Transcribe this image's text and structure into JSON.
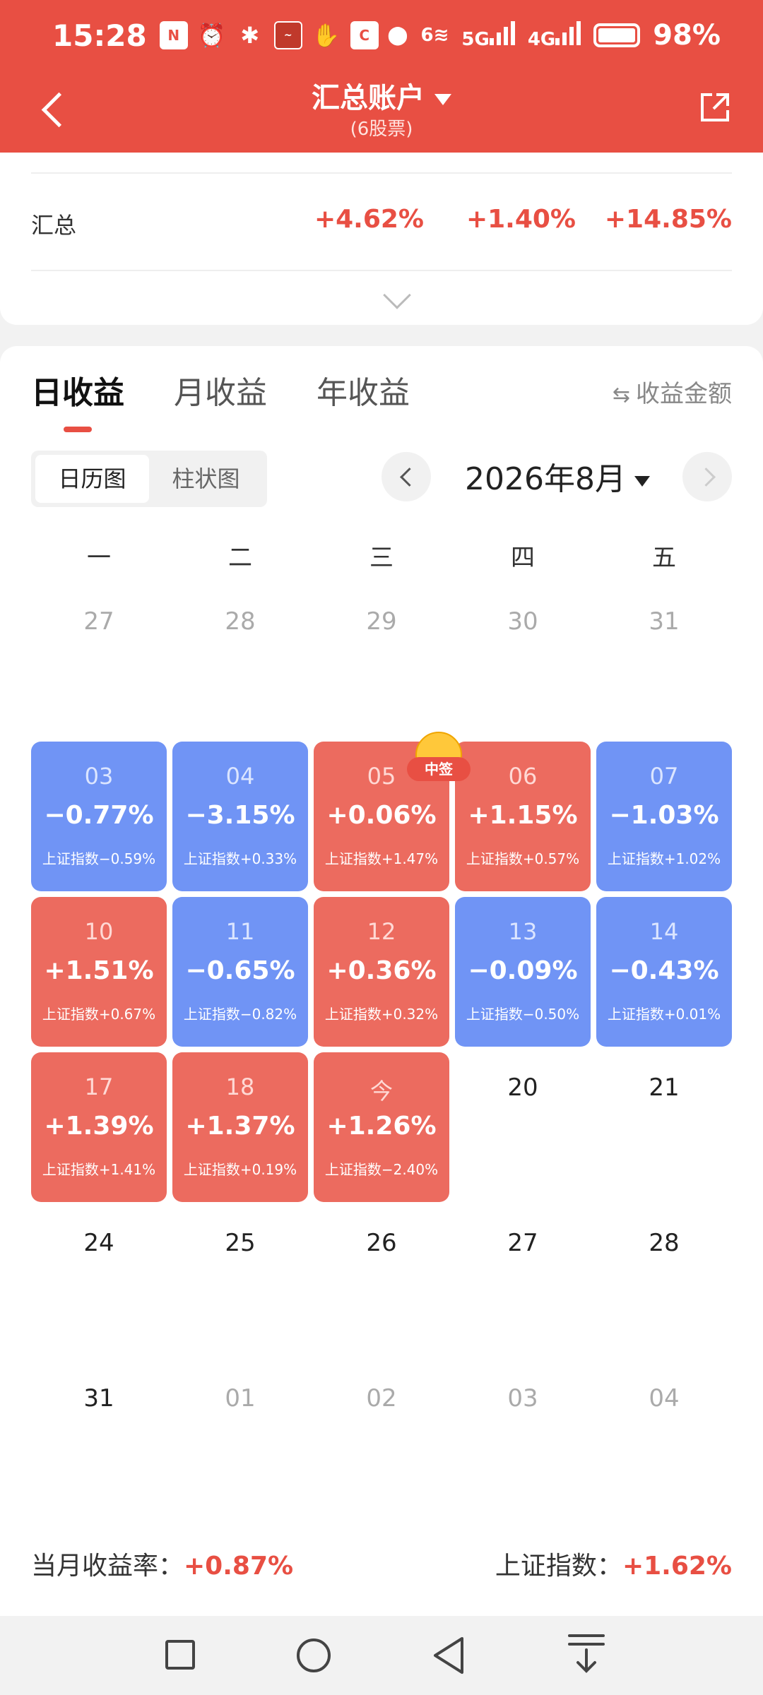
{
  "status": {
    "time": "15:28",
    "battery": "98%",
    "net_5g": "5G",
    "net_4g": "4G",
    "wifi_gen": "6"
  },
  "nav": {
    "title": "汇总账户",
    "subtitle": "(6股票)"
  },
  "summary": {
    "label": "汇总",
    "values": [
      "+4.62%",
      "+1.40%",
      "+14.85%"
    ]
  },
  "tabs": [
    "日收益",
    "月收益",
    "年收益"
  ],
  "toggle_amount": "收益金额",
  "view_switch": [
    "日历图",
    "柱状图"
  ],
  "month_label": "2026年8月",
  "weekdays": [
    "一",
    "二",
    "三",
    "四",
    "五"
  ],
  "badge_text": "中签",
  "days": [
    {
      "d": "27",
      "kind": "faded"
    },
    {
      "d": "28",
      "kind": "faded"
    },
    {
      "d": "29",
      "kind": "faded"
    },
    {
      "d": "30",
      "kind": "faded"
    },
    {
      "d": "31",
      "kind": "faded"
    },
    {
      "d": "03",
      "kind": "down",
      "p": "−0.77%",
      "i": "上证指数−0.59%"
    },
    {
      "d": "04",
      "kind": "down",
      "p": "−3.15%",
      "i": "上证指数+0.33%"
    },
    {
      "d": "05",
      "kind": "up",
      "p": "+0.06%",
      "i": "上证指数+1.47%"
    },
    {
      "d": "06",
      "kind": "up",
      "p": "+1.15%",
      "i": "上证指数+0.57%"
    },
    {
      "d": "07",
      "kind": "down",
      "p": "−1.03%",
      "i": "上证指数+1.02%"
    },
    {
      "d": "10",
      "kind": "up",
      "p": "+1.51%",
      "i": "上证指数+0.67%"
    },
    {
      "d": "11",
      "kind": "down",
      "p": "−0.65%",
      "i": "上证指数−0.82%"
    },
    {
      "d": "12",
      "kind": "up",
      "p": "+0.36%",
      "i": "上证指数+0.32%"
    },
    {
      "d": "13",
      "kind": "down",
      "p": "−0.09%",
      "i": "上证指数−0.50%"
    },
    {
      "d": "14",
      "kind": "down",
      "p": "−0.43%",
      "i": "上证指数+0.01%"
    },
    {
      "d": "17",
      "kind": "up",
      "p": "+1.39%",
      "i": "上证指数+1.41%"
    },
    {
      "d": "18",
      "kind": "up",
      "p": "+1.37%",
      "i": "上证指数+0.19%"
    },
    {
      "d": "今",
      "kind": "up",
      "p": "+1.26%",
      "i": "上证指数−2.40%"
    },
    {
      "d": "20",
      "kind": "plain"
    },
    {
      "d": "21",
      "kind": "plain"
    },
    {
      "d": "24",
      "kind": "plain"
    },
    {
      "d": "25",
      "kind": "plain"
    },
    {
      "d": "26",
      "kind": "plain"
    },
    {
      "d": "27",
      "kind": "plain"
    },
    {
      "d": "28",
      "kind": "plain"
    },
    {
      "d": "31",
      "kind": "plain"
    },
    {
      "d": "01",
      "kind": "faded"
    },
    {
      "d": "02",
      "kind": "faded"
    },
    {
      "d": "03",
      "kind": "faded"
    },
    {
      "d": "04",
      "kind": "faded"
    }
  ],
  "footer": {
    "month_rate_label": "当月收益率：",
    "month_rate_value": "+0.87%",
    "index_label": "上证指数：",
    "index_value": "+1.62%"
  },
  "colors": {
    "brand_red": "#e84f43",
    "gain": "#ec6b5f",
    "loss": "#7094f5"
  }
}
